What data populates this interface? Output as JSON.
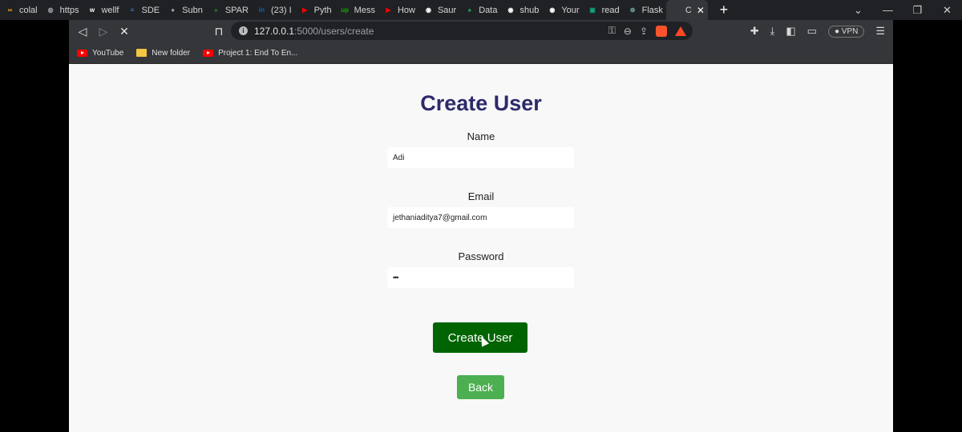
{
  "tabs": [
    {
      "label": "colal",
      "color": "#f9ab00",
      "glyph": "∞"
    },
    {
      "label": "https",
      "color": "#9aa0a6",
      "glyph": "◍"
    },
    {
      "label": "wellf",
      "color": "#ffffff",
      "glyph": "w"
    },
    {
      "label": "SDE",
      "color": "#4285f4",
      "glyph": "≡"
    },
    {
      "label": "Subn",
      "color": "#9aa0a6",
      "glyph": "●"
    },
    {
      "label": "SPAR",
      "color": "#3c8a3c",
      "glyph": "»"
    },
    {
      "label": "(23) I",
      "color": "#0a66c2",
      "glyph": "in"
    },
    {
      "label": "Pyth",
      "color": "#ff0000",
      "glyph": "▶"
    },
    {
      "label": "Mess",
      "color": "#14a800",
      "glyph": "up"
    },
    {
      "label": "How",
      "color": "#ff0000",
      "glyph": "▶"
    },
    {
      "label": "Saur",
      "color": "#ffffff",
      "glyph": "◉"
    },
    {
      "label": "Data",
      "color": "#13aa52",
      "glyph": "♠"
    },
    {
      "label": "shub",
      "color": "#ffffff",
      "glyph": "◉"
    },
    {
      "label": "Your",
      "color": "#ffffff",
      "glyph": "◉"
    },
    {
      "label": "read",
      "color": "#10a37f",
      "glyph": "▣"
    },
    {
      "label": "Flask",
      "color": "#74aa9c",
      "glyph": "⊛"
    },
    {
      "label": "C",
      "color": "#35363a",
      "glyph": "◌",
      "active": true
    }
  ],
  "window_controls": {
    "chevron": "⌄",
    "minimize": "—",
    "restore": "❐",
    "close": "✕"
  },
  "url": {
    "host": "127.0.0.1",
    "path": ":5000/users/create"
  },
  "bookmarks": [
    {
      "label": "YouTube",
      "icon": "youtube-icon"
    },
    {
      "label": "New folder",
      "icon": "folder-icon"
    },
    {
      "label": "Project 1: End To En...",
      "icon": "youtube-icon"
    }
  ],
  "right_icons": {
    "vpn_label": "VPN"
  },
  "form": {
    "title": "Create User",
    "name_label": "Name",
    "name_value": "Adi",
    "email_label": "Email",
    "email_value": "jethaniaditya7@gmail.com",
    "password_label": "Password",
    "password_value": "•••",
    "submit_label": "Create User",
    "back_label": "Back"
  },
  "colors": {
    "title": "#2c2a6a",
    "submit_bg": "#006400",
    "back_bg": "#4caf50",
    "page_bg": "#f8f8f8"
  }
}
